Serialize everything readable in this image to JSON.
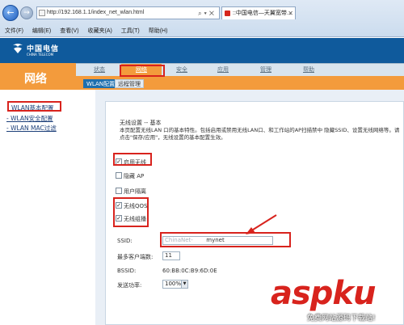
{
  "browser": {
    "url": "http://192.168.1.1/index_net_wlan.html",
    "tab_title": "::中国电信—天翼宽带...",
    "menu": [
      "文件(F)",
      "编辑(E)",
      "查看(V)",
      "收藏夹(A)",
      "工具(T)",
      "帮助(H)"
    ]
  },
  "brand": {
    "name_cn": "中国电信",
    "name_en": "CHINA TELECOM"
  },
  "section": "网络",
  "topnav": [
    "状态",
    "网络",
    "安全",
    "应用",
    "管理",
    "帮助"
  ],
  "subtabs": [
    "WLAN配置",
    "远程管理"
  ],
  "sidebar": [
    "WLAN基本配置",
    "- WLAN安全配置",
    "- WLAN MAC过滤"
  ],
  "panel": {
    "title": "无线设置 -- 基本",
    "description": "本页配置无线LAN 口的基本特性。包括启用或禁用无线LAN口、和工作站的AP扫描禁中 隐藏SSID、设置无线网络等。请点击\"保存/应用\"，无线设置的基本配置生效。",
    "checkboxes": [
      {
        "label": "启用无线",
        "checked": true
      },
      {
        "label": "隐藏 AP",
        "checked": false
      },
      {
        "label": "用户隔离",
        "checked": false
      },
      {
        "label": "无线QOS",
        "checked": true
      },
      {
        "label": "无线组播",
        "checked": true
      }
    ],
    "ssid_label": "SSID:",
    "ssid_prefix": "ChinaNet-",
    "ssid_value": "mynet",
    "max_clients_label": "最多客户端数:",
    "max_clients_value": "11",
    "bssid_label": "BSSID:",
    "bssid_value": "60:BB:0C:B9:6D:0E",
    "tx_power_label": "发送功率:",
    "tx_power_value": "100%"
  },
  "watermark": {
    "brand": "aspku",
    "tagline": "免费网站源码下载站!"
  },
  "colors": {
    "header_blue": "#0f5a9c",
    "accent_orange": "#f39b3c",
    "highlight_red": "#d8231d"
  }
}
